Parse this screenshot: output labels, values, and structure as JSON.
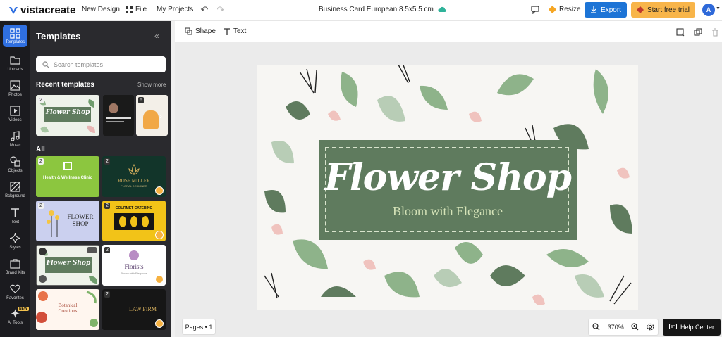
{
  "app": {
    "logo_text": "vistacreate",
    "nav": {
      "new_design": "New Design",
      "file": "File",
      "my_projects": "My Projects"
    },
    "doc_title": "Business Card European 8.5x5.5 cm",
    "resize": "Resize",
    "export": "Export",
    "free_trial": "Start free trial",
    "avatar_initial": "A"
  },
  "rail": {
    "items": [
      {
        "label": "Templates",
        "icon": "templates-icon"
      },
      {
        "label": "Uploads",
        "icon": "folder-icon"
      },
      {
        "label": "Photos",
        "icon": "image-icon"
      },
      {
        "label": "Videos",
        "icon": "video-icon"
      },
      {
        "label": "Music",
        "icon": "music-icon"
      },
      {
        "label": "Objects",
        "icon": "shapes-icon"
      },
      {
        "label": "Bckground",
        "icon": "background-icon"
      },
      {
        "label": "Text",
        "icon": "text-icon"
      },
      {
        "label": "Styles",
        "icon": "sparkle-icon"
      },
      {
        "label": "Brand Kits",
        "icon": "briefcase-icon"
      },
      {
        "label": "Favorites",
        "icon": "heart-icon"
      },
      {
        "label": "AI Tools",
        "icon": "ai-sparkle-icon"
      }
    ],
    "new_badge": "NEW"
  },
  "panel": {
    "title": "Templates",
    "search_placeholder": "Search templates",
    "recent_title": "Recent templates",
    "show_more": "Show more",
    "all_title": "All",
    "recent": [
      {
        "count": "2",
        "label": "Flower Shop"
      },
      {
        "count": "",
        "label": ""
      },
      {
        "count": "6",
        "label": ""
      }
    ],
    "grid": [
      {
        "count": "2",
        "title": "Health & Wellness Clinic",
        "sub": ""
      },
      {
        "count": "2",
        "title": "ROSE MILLER",
        "sub": "FLORAL DESIGNER"
      },
      {
        "count": "2",
        "title": "FLOWER SHOP",
        "sub": ""
      },
      {
        "count": "2",
        "title": "GOURMET CATERING",
        "sub": ""
      },
      {
        "count": "",
        "title": "Flower Shop",
        "sub": ""
      },
      {
        "count": "2",
        "title": "Florists",
        "sub": "Bloom with Elegance"
      },
      {
        "count": "",
        "title": "Botanical Creations",
        "sub": ""
      },
      {
        "count": "2",
        "title": "LAW FIRM",
        "sub": ""
      }
    ]
  },
  "toolbar": {
    "shape": "Shape",
    "text": "Text"
  },
  "card": {
    "title": "Flower Shop",
    "subtitle": "Bloom with Elegance"
  },
  "footer": {
    "pages": "Pages • 1",
    "zoom": "370%",
    "help": "Help Center"
  },
  "colors": {
    "accent": "#1d74d6",
    "trial": "#f8b54a",
    "banner": "#5f7b5e",
    "rail": "#1b1b1f",
    "panel": "#2a2a2e"
  }
}
